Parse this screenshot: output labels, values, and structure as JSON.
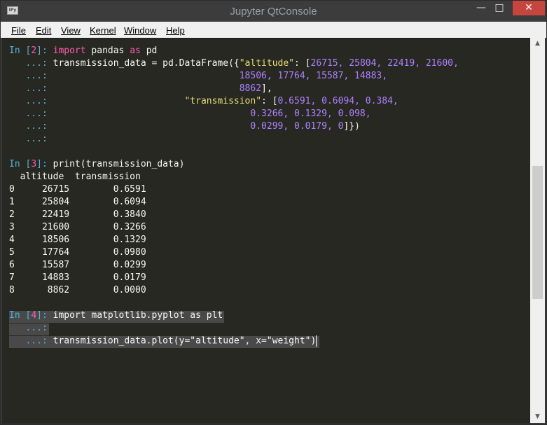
{
  "window": {
    "title": "Jupyter QtConsole",
    "icon": "IPy",
    "min_glyph": "—",
    "max_glyph": "□",
    "close_glyph": "✕"
  },
  "menu": [
    "File",
    "Edit",
    "View",
    "Kernel",
    "Window",
    "Help"
  ],
  "console": {
    "in_label": "In [",
    "in_close": "]:",
    "cont": "...:",
    "cells": [
      {
        "num": "2",
        "l1_kw1": "import",
        "l1_mod": " pandas ",
        "l1_kw2": "as",
        "l1_alias": " pd",
        "l2_a": " transmission_data = pd.DataFrame({",
        "l2_str": "\"altitude\"",
        "l2_b": ": [",
        "l2_nums": "26715, 25804, 22419, 21600,",
        "l3": "18506, 17764, 15587, 14883,",
        "l4_num": "8862",
        "l4_end": "],",
        "l5_str": "\"transmission\"",
        "l5_b": ": [",
        "l5_nums": "0.6591, 0.6094, 0.384,",
        "l6": "0.3266, 0.1329, 0.098,",
        "l7_nums": "0.0299, 0.0179, 0",
        "l7_end": "]})"
      },
      {
        "num": "3",
        "code": "print(transmission_data)",
        "header": "  altitude  transmission",
        "rows": [
          "0     26715        0.6591",
          "1     25804        0.6094",
          "2     22419        0.3840",
          "3     21600        0.3266",
          "4     18506        0.1329",
          "5     17764        0.0980",
          "6     15587        0.0299",
          "7     14883        0.0179",
          "8      8862        0.0000"
        ]
      },
      {
        "num": "4",
        "l1": "import matplotlib.pyplot as plt",
        "l3": "transmission_data.plot(y=\"altitude\", x=\"weight\")"
      }
    ]
  },
  "scrollbar": {
    "up": "▲",
    "down": "▼"
  }
}
